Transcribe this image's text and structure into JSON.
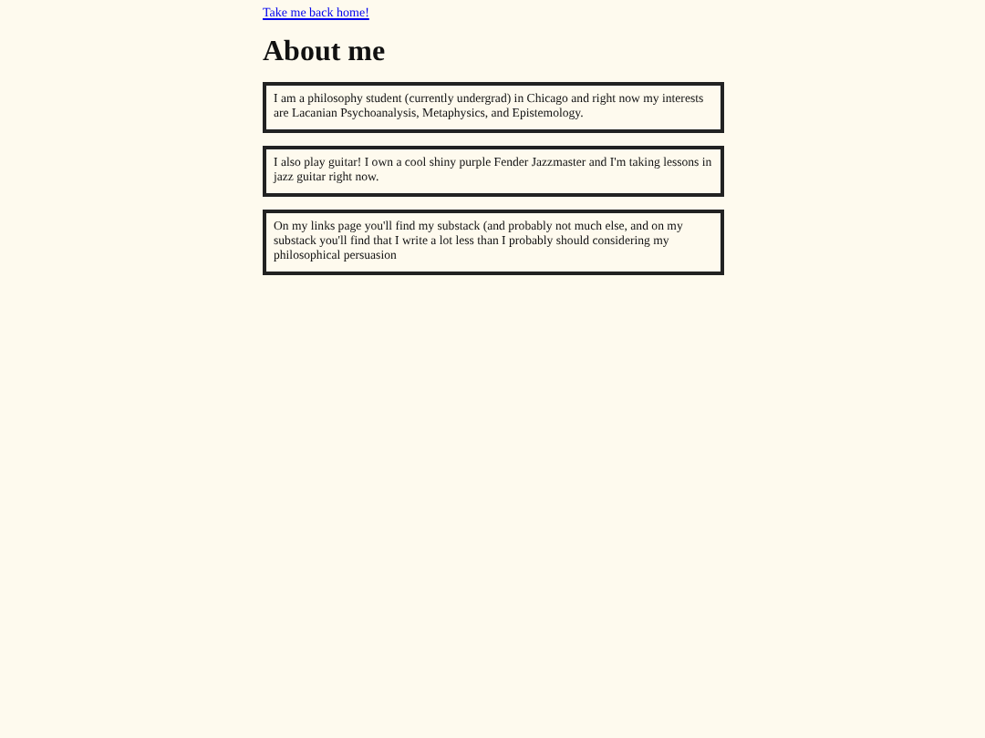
{
  "home_link": "Take me back home!",
  "heading": "About me",
  "paragraphs": [
    "I am a philosophy student (currently undergrad) in Chicago and right now my interests are Lacanian Psychoanalysis, Metaphysics, and Epistemology.",
    "I also play guitar! I own a cool shiny purple Fender Jazzmaster and I'm taking lessons in jazz guitar right now.",
    "On my links page you'll find my substack (and probably not much else, and on my substack you'll find that I write a lot less than I probably should considering my philosophical persuasion"
  ]
}
